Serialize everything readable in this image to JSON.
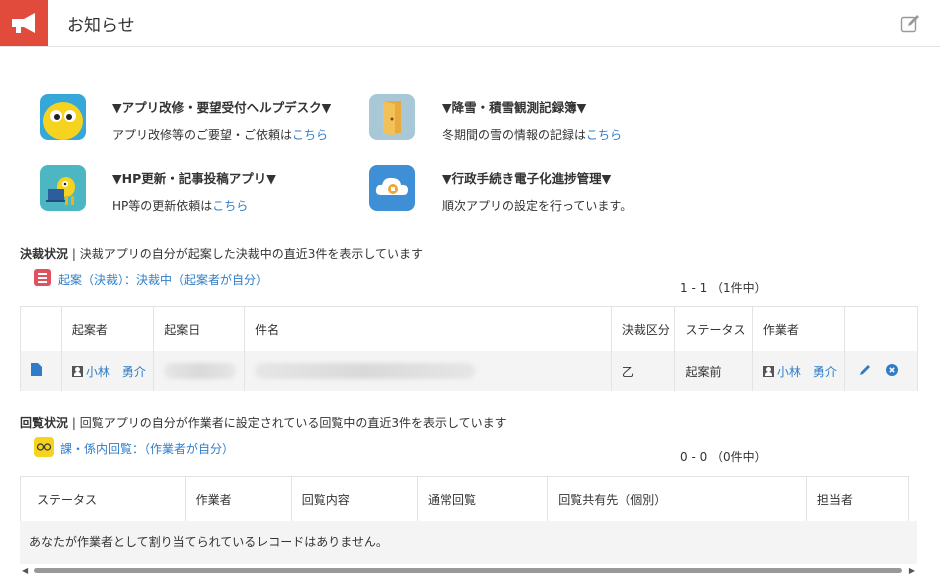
{
  "header": {
    "title": "お知らせ",
    "logo_icon": "megaphone-icon",
    "edit_icon": "edit-icon"
  },
  "apps": [
    {
      "title": "▼アプリ改修・要望受付ヘルプデスク▼",
      "desc": "アプリ改修等のご要望・ご依頼は",
      "link": "こちら",
      "icon": "yellow-character-icon"
    },
    {
      "title": "▼降雪・積雪観測記録簿▼",
      "desc": "冬期間の雪の情報の記録は",
      "link": "こちら",
      "icon": "door-icon"
    },
    {
      "title": "▼HP更新・記事投稿アプリ▼",
      "desc": "HP等の更新依頼は",
      "link": "こちら",
      "icon": "laptop-character-icon"
    },
    {
      "title": "▼行政手続き電子化進捗管理▼",
      "desc": "順次アプリの設定を行っています。",
      "link": "",
      "icon": "cloud-icon"
    }
  ],
  "approval": {
    "heading": "決裁状況",
    "description": "決裁アプリの自分が起案した決裁中の直近3件を表示しています",
    "view_link": "起案（決裁）：決裁中（起案者が自分）",
    "pager": "1 - 1 （1件中）",
    "columns": [
      "起案者",
      "起案日",
      "件名",
      "決裁区分",
      "ステータス",
      "作業者"
    ],
    "rows": [
      {
        "drafter": "小林　勇介",
        "date": "",
        "subject": "",
        "category": "乙",
        "status": "起案前",
        "worker": "小林　勇介"
      }
    ]
  },
  "circulation": {
    "heading": "回覧状況",
    "description": "回覧アプリの自分が作業者に設定されている回覧中の直近3件を表示しています",
    "view_link": "課・係内回覧：（作業者が自分）",
    "pager": "0 - 0 （0件中）",
    "columns": [
      "ステータス",
      "作業者",
      "回覧内容",
      "通常回覧",
      "回覧共有先（個別）",
      "担当者"
    ],
    "empty_message": "あなたが作業者として割り当てられているレコードはありません。"
  },
  "colors": {
    "brand": "#e04b3c",
    "link": "#2f7dc7"
  }
}
